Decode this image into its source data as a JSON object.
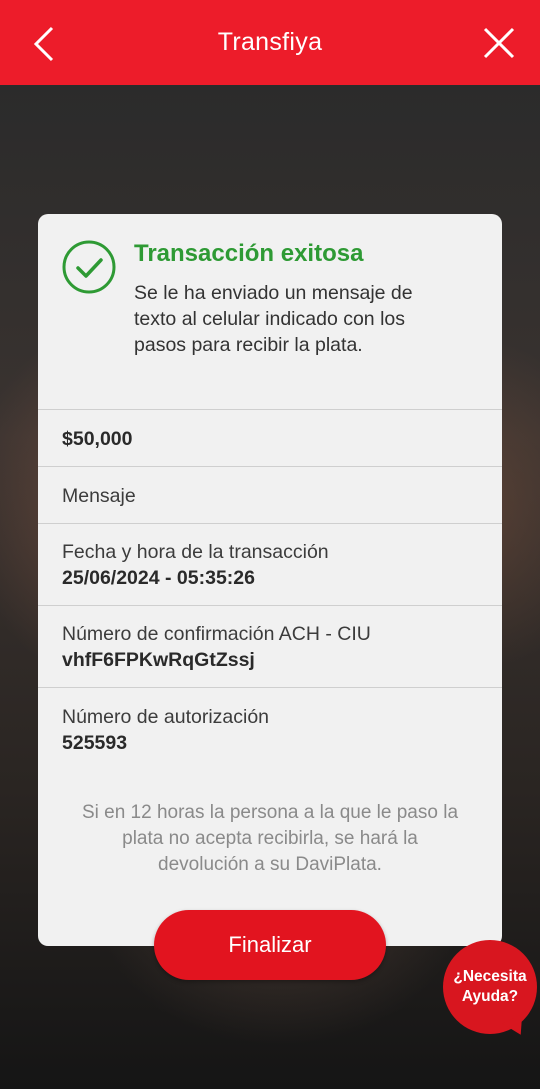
{
  "header": {
    "title": "Transfiya",
    "back_icon": "chevron-left-icon",
    "close_icon": "close-icon"
  },
  "status": {
    "icon": "check-circle-icon",
    "title": "Transacción exitosa",
    "message": "Se le ha enviado un mensaje de texto al celular indicado con los pasos para recibir la plata."
  },
  "details": {
    "amount": "$50,000",
    "message_label": "Mensaje",
    "datetime_label": "Fecha y hora de la transacción",
    "datetime_value": "25/06/2024 - 05:35:26",
    "ach_label": "Número de confirmación ACH - CIU",
    "ach_value": "vhfF6FPKwRqGtZssj",
    "auth_label": "Número de autorización",
    "auth_value": "525593"
  },
  "note": "Si en 12 horas la persona a la que le paso la plata no acepta recibirla, se hará la devolución a su DaviPlata.",
  "actions": {
    "finish_label": "Finalizar",
    "help_label": "¿Necesita\nAyuda?"
  },
  "colors": {
    "brand_red": "#ed1c2a",
    "success_green": "#2e9a34"
  }
}
